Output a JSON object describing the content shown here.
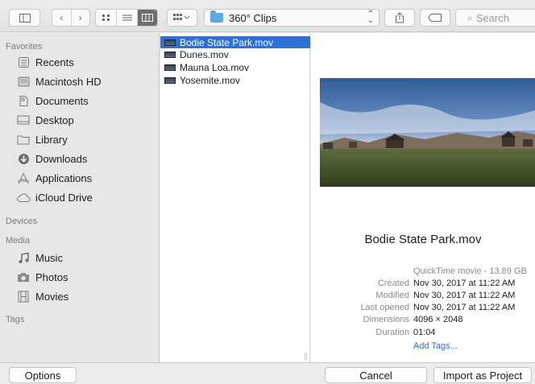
{
  "toolbar": {
    "folder_popup_label": "360° Clips",
    "search_placeholder": "Search",
    "icons": [
      "sidebar-toggle-icon",
      "back-icon",
      "forward-icon",
      "icon-view-icon",
      "list-view-icon",
      "column-view-icon",
      "arrange-icon",
      "share-icon",
      "tag-icon",
      "search-icon"
    ]
  },
  "sidebar": {
    "favorites_title": "Favorites",
    "favorites": [
      {
        "label": "Recents",
        "icon": "recents-icon"
      },
      {
        "label": "Macintosh HD",
        "icon": "hard-drive-icon"
      },
      {
        "label": "Documents",
        "icon": "documents-icon"
      },
      {
        "label": "Desktop",
        "icon": "desktop-icon"
      },
      {
        "label": "Library",
        "icon": "folder-icon"
      },
      {
        "label": "Downloads",
        "icon": "downloads-icon"
      },
      {
        "label": "Applications",
        "icon": "applications-icon"
      },
      {
        "label": "iCloud Drive",
        "icon": "cloud-icon"
      }
    ],
    "devices_title": "Devices",
    "media_title": "Media",
    "media": [
      {
        "label": "Music",
        "icon": "music-icon"
      },
      {
        "label": "Photos",
        "icon": "camera-icon"
      },
      {
        "label": "Movies",
        "icon": "film-icon"
      }
    ],
    "tags_title": "Tags"
  },
  "files": [
    {
      "name": "Bodie State Park.mov",
      "selected": true
    },
    {
      "name": "Dunes.mov",
      "selected": false
    },
    {
      "name": "Mauna Loa.mov",
      "selected": false
    },
    {
      "name": "Yosemite.mov",
      "selected": false
    }
  ],
  "preview": {
    "title": "Bodie State Park.mov",
    "kind": "QuickTime movie - 13.89 GB",
    "info": [
      {
        "key": "Created",
        "value": "Nov 30, 2017 at 11:22 AM"
      },
      {
        "key": "Modified",
        "value": "Nov 30, 2017 at 11:22 AM"
      },
      {
        "key": "Last opened",
        "value": "Nov 30, 2017 at 11:22 AM"
      },
      {
        "key": "Dimensions",
        "value": "4096 × 2048"
      },
      {
        "key": "Duration",
        "value": "01:04"
      }
    ],
    "add_tags": "Add Tags..."
  },
  "bottom": {
    "options_label": "Options",
    "cancel_label": "Cancel",
    "import_label": "Import as Project"
  },
  "colors": {
    "selection": "#2d72d9",
    "link": "#2a6fdb",
    "folder": "#54a9e6"
  }
}
